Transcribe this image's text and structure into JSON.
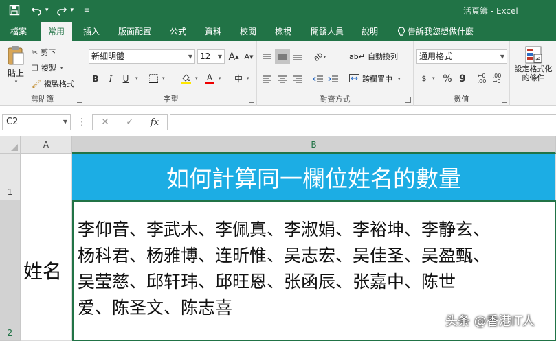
{
  "window": {
    "title": "活頁簿 - Excel"
  },
  "qat": {
    "save_icon": "save-icon",
    "undo_icon": "undo-icon",
    "redo_icon": "redo-icon",
    "customize_icon": "customize-icon"
  },
  "tabs": [
    {
      "label": "檔案"
    },
    {
      "label": "常用"
    },
    {
      "label": "插入"
    },
    {
      "label": "版面配置"
    },
    {
      "label": "公式"
    },
    {
      "label": "資料"
    },
    {
      "label": "校閱"
    },
    {
      "label": "檢視"
    },
    {
      "label": "開發人員"
    },
    {
      "label": "說明"
    }
  ],
  "tellme": "告訴我您想做什麼",
  "ribbon": {
    "clipboard": {
      "paste": "貼上",
      "cut": "剪下",
      "copy": "複製",
      "format_painter": "複製格式",
      "label": "剪貼簿"
    },
    "font": {
      "name": "新細明體",
      "size": "12",
      "label": "字型",
      "bold": "B",
      "italic": "I",
      "underline": "U",
      "grow": "A",
      "shrink": "A",
      "phonetic": "中",
      "fontcolor": "A"
    },
    "alignment": {
      "wrap": "自動換列",
      "merge": "跨欄置中",
      "label": "對齊方式"
    },
    "number": {
      "format": "通用格式",
      "percent": "%",
      "comma": "9",
      "label": "數值"
    },
    "styles": {
      "conditional": "設定格式化的條件"
    }
  },
  "formula_bar": {
    "name_box": "C2",
    "cancel": "✕",
    "enter": "✓",
    "fx": "fx",
    "value": ""
  },
  "sheet": {
    "columns": [
      "A",
      "B"
    ],
    "rows": [
      "1",
      "2"
    ],
    "title": "如何計算同一欄位姓名的數量",
    "label": "姓名",
    "names_lines": [
      "李仰音、李武木、李佩真、李淑娟、李裕坤、李静玄、",
      "杨科君、杨雅博、连昕惟、吴志宏、吴佳圣、吴盈甄、",
      "吴莹慈、邱轩玮、邱旺恩、张函辰、张嘉中、陈世",
      "爱、陈圣文、陈志喜"
    ]
  },
  "watermark": "头条 @香港IT人"
}
